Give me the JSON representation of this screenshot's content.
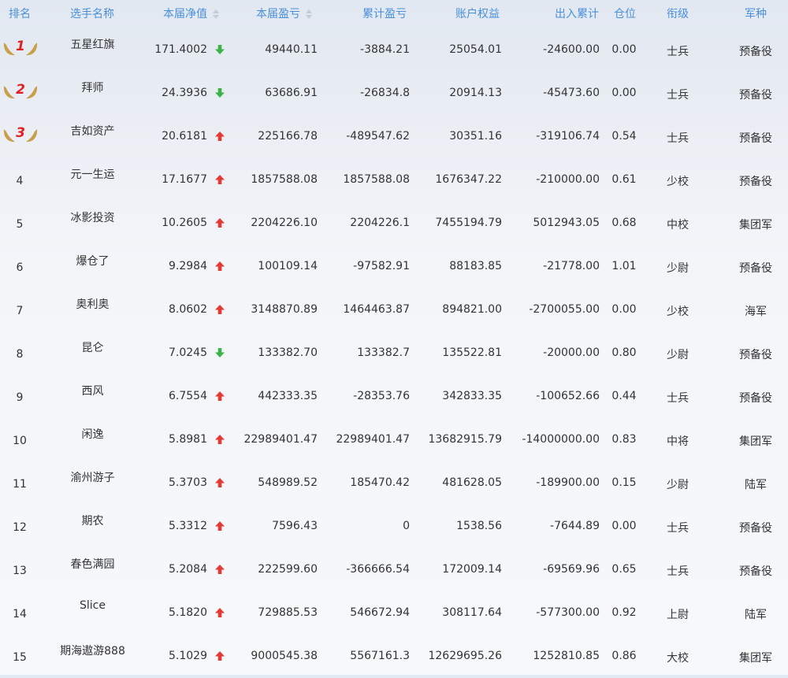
{
  "headers": {
    "rank": "排名",
    "name": "选手名称",
    "nav": "本届净值",
    "profit": "本届盈亏",
    "cumulative": "累计盈亏",
    "equity": "账户权益",
    "flow": "出入累计",
    "position": "仓位",
    "title": "衔级",
    "army": "军种"
  },
  "colors": {
    "header_text": "#4a90d9",
    "up_arrow": "#e53935",
    "down_arrow": "#3bb34a",
    "badge_wing": "#c9a04a",
    "badge_number": "#e02020"
  },
  "rows": [
    {
      "rank": "1",
      "badge": true,
      "name": "五星红旗",
      "nav": "171.4002",
      "trend": "down",
      "profit": "49440.11",
      "cumulative": "-3884.21",
      "equity": "25054.01",
      "flow": "-24600.00",
      "position": "0.00",
      "title": "士兵",
      "army": "预备役"
    },
    {
      "rank": "2",
      "badge": true,
      "name": "拜师",
      "nav": "24.3936",
      "trend": "down",
      "profit": "63686.91",
      "cumulative": "-26834.8",
      "equity": "20914.13",
      "flow": "-45473.60",
      "position": "0.00",
      "title": "士兵",
      "army": "预备役"
    },
    {
      "rank": "3",
      "badge": true,
      "name": "吉如资产",
      "nav": "20.6181",
      "trend": "up",
      "profit": "225166.78",
      "cumulative": "-489547.62",
      "equity": "30351.16",
      "flow": "-319106.74",
      "position": "0.54",
      "title": "士兵",
      "army": "预备役"
    },
    {
      "rank": "4",
      "badge": false,
      "name": "元一生运",
      "nav": "17.1677",
      "trend": "up",
      "profit": "1857588.08",
      "cumulative": "1857588.08",
      "equity": "1676347.22",
      "flow": "-210000.00",
      "position": "0.61",
      "title": "少校",
      "army": "预备役"
    },
    {
      "rank": "5",
      "badge": false,
      "name": "冰影投资",
      "nav": "10.2605",
      "trend": "up",
      "profit": "2204226.10",
      "cumulative": "2204226.1",
      "equity": "7455194.79",
      "flow": "5012943.05",
      "position": "0.68",
      "title": "中校",
      "army": "集团军"
    },
    {
      "rank": "6",
      "badge": false,
      "name": "爆仓了",
      "nav": "9.2984",
      "trend": "up",
      "profit": "100109.14",
      "cumulative": "-97582.91",
      "equity": "88183.85",
      "flow": "-21778.00",
      "position": "1.01",
      "title": "少尉",
      "army": "预备役"
    },
    {
      "rank": "7",
      "badge": false,
      "name": "奥利奥",
      "nav": "8.0602",
      "trend": "up",
      "profit": "3148870.89",
      "cumulative": "1464463.87",
      "equity": "894821.00",
      "flow": "-2700055.00",
      "position": "0.00",
      "title": "少校",
      "army": "海军"
    },
    {
      "rank": "8",
      "badge": false,
      "name": "昆仑",
      "nav": "7.0245",
      "trend": "down",
      "profit": "133382.70",
      "cumulative": "133382.7",
      "equity": "135522.81",
      "flow": "-20000.00",
      "position": "0.80",
      "title": "少尉",
      "army": "预备役"
    },
    {
      "rank": "9",
      "badge": false,
      "name": "西风",
      "nav": "6.7554",
      "trend": "up",
      "profit": "442333.35",
      "cumulative": "-28353.76",
      "equity": "342833.35",
      "flow": "-100652.66",
      "position": "0.44",
      "title": "士兵",
      "army": "预备役"
    },
    {
      "rank": "10",
      "badge": false,
      "name": "闲逸",
      "nav": "5.8981",
      "trend": "up",
      "profit": "22989401.47",
      "cumulative": "22989401.47",
      "equity": "13682915.79",
      "flow": "-14000000.00",
      "position": "0.83",
      "title": "中将",
      "army": "集团军"
    },
    {
      "rank": "11",
      "badge": false,
      "name": "渝州游子",
      "nav": "5.3703",
      "trend": "up",
      "profit": "548989.52",
      "cumulative": "185470.42",
      "equity": "481628.05",
      "flow": "-189900.00",
      "position": "0.15",
      "title": "少尉",
      "army": "陆军"
    },
    {
      "rank": "12",
      "badge": false,
      "name": "期农",
      "nav": "5.3312",
      "trend": "up",
      "profit": "7596.43",
      "cumulative": "0",
      "equity": "1538.56",
      "flow": "-7644.89",
      "position": "0.00",
      "title": "士兵",
      "army": "预备役"
    },
    {
      "rank": "13",
      "badge": false,
      "name": "春色满园",
      "nav": "5.2084",
      "trend": "up",
      "profit": "222599.60",
      "cumulative": "-366666.54",
      "equity": "172009.14",
      "flow": "-69569.96",
      "position": "0.65",
      "title": "士兵",
      "army": "预备役"
    },
    {
      "rank": "14",
      "badge": false,
      "name": "Slice",
      "nav": "5.1820",
      "trend": "up",
      "profit": "729885.53",
      "cumulative": "546672.94",
      "equity": "308117.64",
      "flow": "-577300.00",
      "position": "0.92",
      "title": "上尉",
      "army": "陆军"
    },
    {
      "rank": "15",
      "badge": false,
      "name": "期海遨游888",
      "nav": "5.1029",
      "trend": "up",
      "profit": "9000545.38",
      "cumulative": "5567161.3",
      "equity": "12629695.26",
      "flow": "1252810.85",
      "position": "0.86",
      "title": "大校",
      "army": "集团军"
    }
  ]
}
